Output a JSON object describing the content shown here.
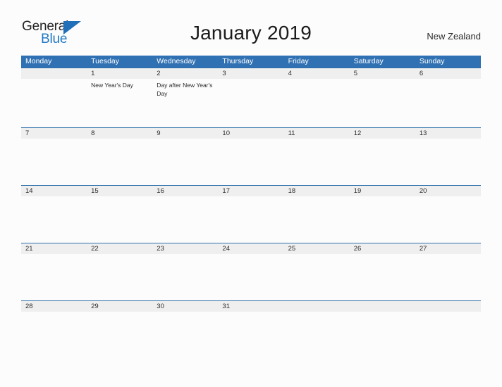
{
  "brand": {
    "name_part1": "General",
    "name_part2": "Blue",
    "flag_icon": "blue-triangle-flag-icon"
  },
  "header": {
    "title": "January 2019",
    "country": "New Zealand"
  },
  "calendar": {
    "weekdays": [
      "Monday",
      "Tuesday",
      "Wednesday",
      "Thursday",
      "Friday",
      "Saturday",
      "Sunday"
    ],
    "colors": {
      "header_blue": "#3071b3",
      "row_rule_blue": "#2e6da9",
      "date_band_gray": "#efefef",
      "page_background": "#fcfcfc",
      "logo_blue": "#1f78c1"
    },
    "weeks": [
      {
        "days": [
          {
            "date": "",
            "event": ""
          },
          {
            "date": "1",
            "event": "New Year's Day"
          },
          {
            "date": "2",
            "event": "Day after New Year's Day"
          },
          {
            "date": "3",
            "event": ""
          },
          {
            "date": "4",
            "event": ""
          },
          {
            "date": "5",
            "event": ""
          },
          {
            "date": "6",
            "event": ""
          }
        ]
      },
      {
        "days": [
          {
            "date": "7",
            "event": ""
          },
          {
            "date": "8",
            "event": ""
          },
          {
            "date": "9",
            "event": ""
          },
          {
            "date": "10",
            "event": ""
          },
          {
            "date": "11",
            "event": ""
          },
          {
            "date": "12",
            "event": ""
          },
          {
            "date": "13",
            "event": ""
          }
        ]
      },
      {
        "days": [
          {
            "date": "14",
            "event": ""
          },
          {
            "date": "15",
            "event": ""
          },
          {
            "date": "16",
            "event": ""
          },
          {
            "date": "17",
            "event": ""
          },
          {
            "date": "18",
            "event": ""
          },
          {
            "date": "19",
            "event": ""
          },
          {
            "date": "20",
            "event": ""
          }
        ]
      },
      {
        "days": [
          {
            "date": "21",
            "event": ""
          },
          {
            "date": "22",
            "event": ""
          },
          {
            "date": "23",
            "event": ""
          },
          {
            "date": "24",
            "event": ""
          },
          {
            "date": "25",
            "event": ""
          },
          {
            "date": "26",
            "event": ""
          },
          {
            "date": "27",
            "event": ""
          }
        ]
      },
      {
        "days": [
          {
            "date": "28",
            "event": ""
          },
          {
            "date": "29",
            "event": ""
          },
          {
            "date": "30",
            "event": ""
          },
          {
            "date": "31",
            "event": ""
          },
          {
            "date": "",
            "event": ""
          },
          {
            "date": "",
            "event": ""
          },
          {
            "date": "",
            "event": ""
          }
        ]
      }
    ]
  }
}
